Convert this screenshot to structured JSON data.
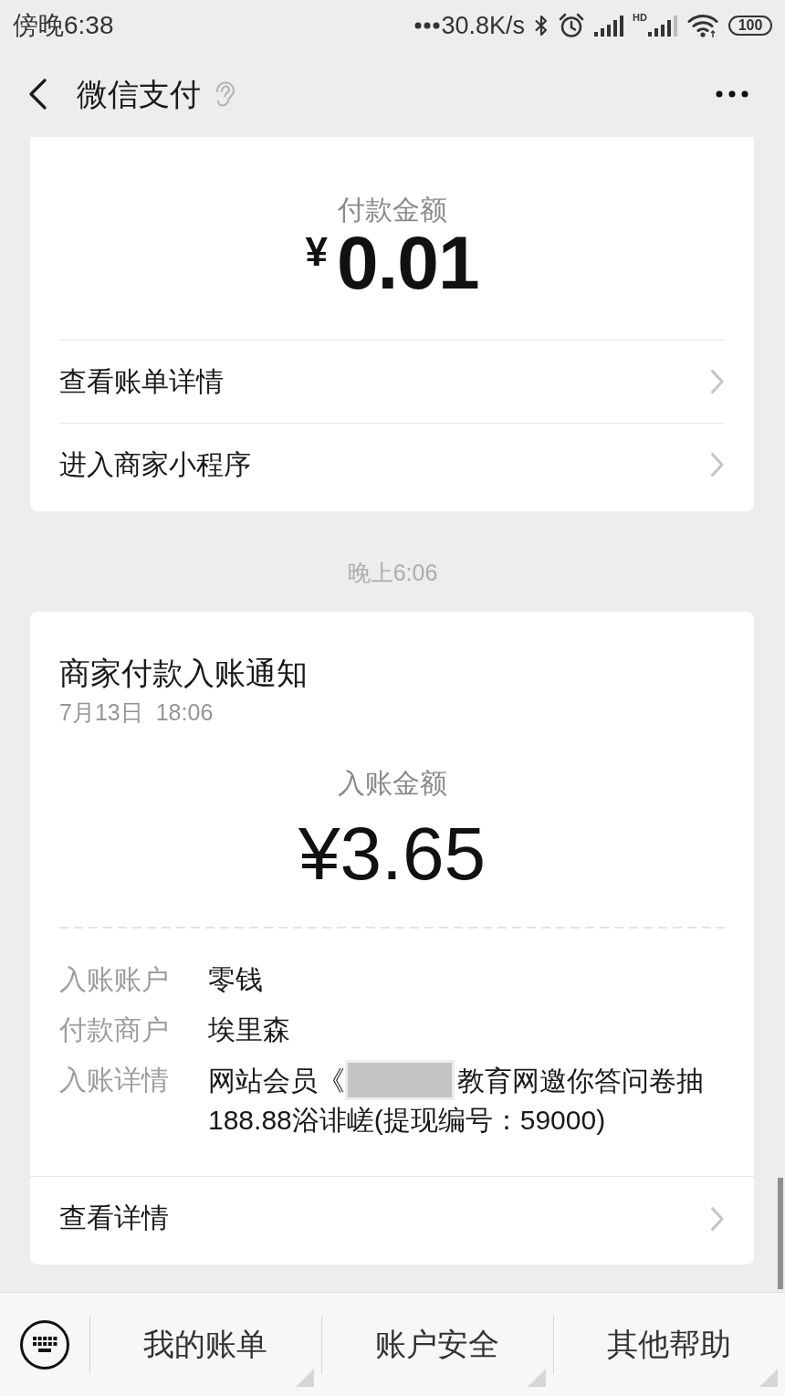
{
  "status_bar": {
    "time": "傍晚6:38",
    "network_speed": "30.8K/s",
    "signal_badge": "HD",
    "battery": "100"
  },
  "header": {
    "title": "微信支付"
  },
  "payment_card": {
    "amount_label": "付款金额",
    "currency": "¥",
    "amount": "0.01",
    "links": [
      {
        "label": "查看账单详情"
      },
      {
        "label": "进入商家小程序"
      }
    ]
  },
  "timestamp": "晚上6:06",
  "notice_card": {
    "title": "商家付款入账通知",
    "date": "7月13日",
    "time": "18:06",
    "amount_label": "入账金额",
    "amount": "¥3.65",
    "fields": [
      {
        "label": "入账账户",
        "lines": [
          [
            {
              "kind": "text",
              "text": "零钱"
            }
          ]
        ]
      },
      {
        "label": "付款商户",
        "lines": [
          [
            {
              "kind": "text",
              "text": "埃里森"
            }
          ]
        ]
      },
      {
        "label": "入账详情",
        "lines": [
          [
            {
              "kind": "text",
              "text": "网站会员《"
            },
            {
              "kind": "redacted"
            },
            {
              "kind": "text",
              "text": "教育网邀你答问卷抽"
            }
          ],
          [
            {
              "kind": "text",
              "text": "188.88浴诽嵯(提现编号：59000)"
            }
          ]
        ]
      }
    ],
    "link": {
      "label": "查看详情"
    }
  },
  "bottom_menu": {
    "items": [
      {
        "label": "我的账单"
      },
      {
        "label": "账户安全"
      },
      {
        "label": "其他帮助"
      }
    ]
  }
}
